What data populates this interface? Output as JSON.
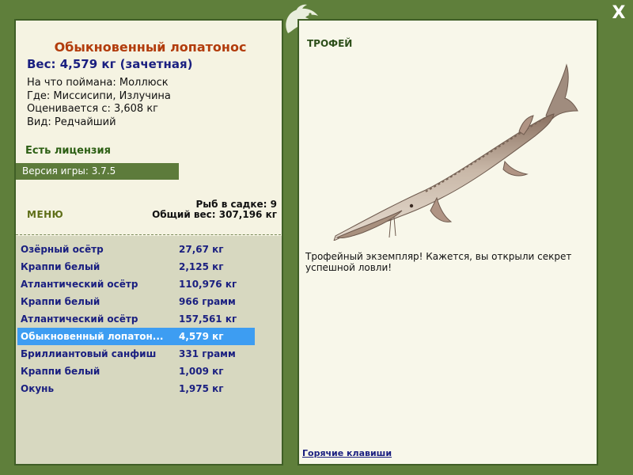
{
  "fish": {
    "title": "Обыкновенный лопатонос",
    "weight": "Вес: 4,579 кг (зачетная)",
    "caught_on": "На что поймана: Моллюск",
    "where": "Где: Миссисипи, Излучина",
    "valued_from": "Оценивается с: 3,608 кг",
    "kind": "Вид: Редчайший"
  },
  "license": "Есть лицензия",
  "version": "Версия игры: 3.7.5",
  "menu_label": "МЕНЮ",
  "stats": {
    "fish_in_keepnet": "Рыб в садке: 9",
    "total_weight": "Общий вес: 307,196 кг"
  },
  "catch_list": [
    {
      "name": "Озёрный осётр",
      "weight": "27,67 кг"
    },
    {
      "name": "Краппи белый",
      "weight": "2,125 кг"
    },
    {
      "name": "Атлантический осётр",
      "weight": "110,976 кг"
    },
    {
      "name": "Краппи белый",
      "weight": "966 грамм"
    },
    {
      "name": "Атлантический осётр",
      "weight": "157,561 кг"
    },
    {
      "name": "Обыкновенный лопатон...",
      "weight": "4,579 кг"
    },
    {
      "name": "Бриллиантовый санфиш",
      "weight": "331 грамм"
    },
    {
      "name": "Краппи белый",
      "weight": "1,009 кг"
    },
    {
      "name": "Окунь",
      "weight": "1,975 кг"
    }
  ],
  "selected_index": 5,
  "trophy": {
    "label": "ТРОФЕЙ",
    "text": "Трофейный экземпляр! Кажется, вы открыли секрет успешной ловли!"
  },
  "hotkeys": "Горячие клавиши",
  "close_label": "X",
  "colors": {
    "frame": "#5f7f3b",
    "title": "#b23c0c",
    "list_text": "#1a1f80",
    "selected": "#3d9df2"
  }
}
